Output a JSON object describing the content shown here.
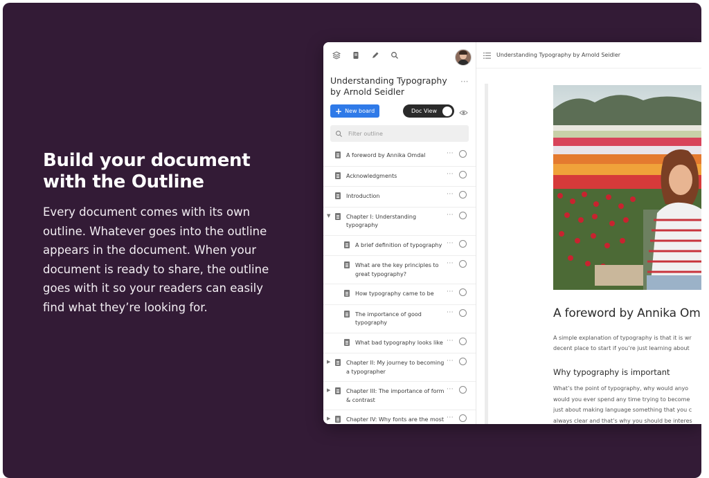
{
  "hero": {
    "title": "Build your document\nwith the Outline",
    "body": "Every document comes with its own outline. Whatever goes into the outline appears in the document. When your document is ready to share, the outline goes with it so your readers can easily find what they’re looking for."
  },
  "sidebar": {
    "toolbar_icons": [
      "layers-icon",
      "document-icon",
      "pen-icon",
      "search-icon"
    ],
    "doc_title": "Understanding Typography\nby Arnold Seidler",
    "new_board_label": "New board",
    "doc_view_label": "Doc View",
    "doc_view_on": true,
    "filter_placeholder": "Filter outline",
    "outline": [
      {
        "label": "A foreword by Annika Omdal",
        "level": 0,
        "expandable": false
      },
      {
        "label": "Acknowledgments",
        "level": 0,
        "expandable": false
      },
      {
        "label": "Introduction",
        "level": 0,
        "expandable": false
      },
      {
        "label": "Chapter I: Understanding\ntypography",
        "level": 0,
        "expandable": true,
        "expanded": true
      },
      {
        "label": "A brief definition of typography",
        "level": 1,
        "expandable": false
      },
      {
        "label": "What are the key principles to\ngreat typography?",
        "level": 1,
        "expandable": false
      },
      {
        "label": "How typography came to be",
        "level": 1,
        "expandable": false
      },
      {
        "label": "The importance of good\ntypography",
        "level": 1,
        "expandable": false
      },
      {
        "label": "What bad typography looks like",
        "level": 1,
        "expandable": false
      },
      {
        "label": "Chapter II: My journey to becoming\na typographer",
        "level": 0,
        "expandable": true,
        "expanded": false
      },
      {
        "label": "Chapter III: The importance of form\n& contrast",
        "level": 0,
        "expandable": true,
        "expanded": false
      },
      {
        "label": "Chapter IV: Why fonts are the most",
        "level": 0,
        "expandable": true,
        "expanded": false
      }
    ]
  },
  "main": {
    "breadcrumb": "Understanding Typography by Arnold Seidler",
    "heading": "A foreword by Annika Om",
    "intro": "A simple explanation of typography is that it is wr\ndecent place to start if you’re just learning about",
    "subheading": "Why typography is important",
    "body": "What’s the point of typography, why would anyo\nwould you ever spend any time trying to become\njust about making language something that you c\nalways clear and that’s why you should be interes"
  },
  "colors": {
    "background": "#331b36",
    "accent": "#2f7ae8",
    "toggle": "#2a2a2a"
  }
}
